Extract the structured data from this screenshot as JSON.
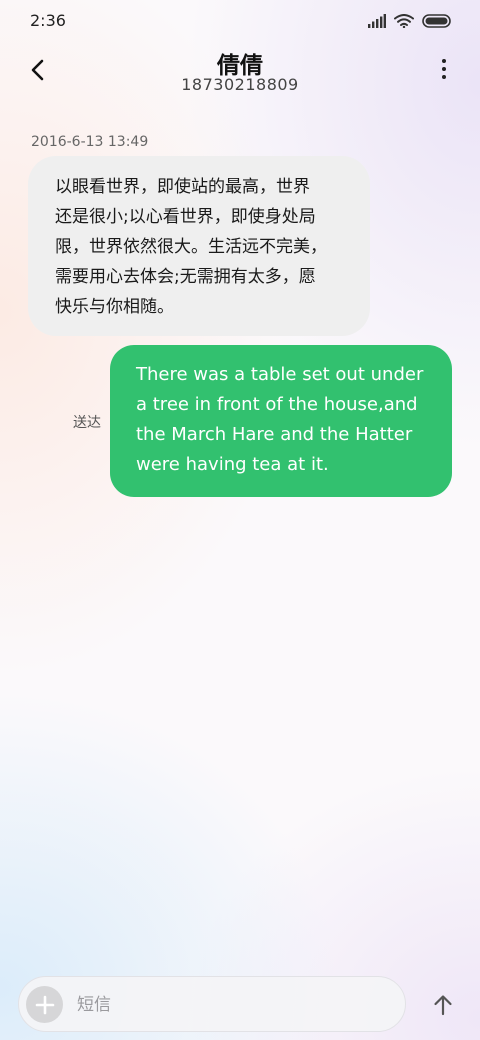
{
  "status_bar": {
    "time": "2:36",
    "icons": [
      "signal-icon",
      "wifi-icon",
      "battery-icon"
    ]
  },
  "header": {
    "contact_name": "倩倩",
    "contact_number": "18730218809",
    "icons": [
      "back-arrow-icon",
      "more-vertical-icon"
    ]
  },
  "conversation": {
    "timestamp": "2016-6-13 13:49",
    "incoming": {
      "lines": [
        "以眼看世界，即使站的最高，世界",
        "还是很小;以心看世界，即使身处局",
        "限，世界依然很大。生活远不完美，",
        "需要用心去体会;无需拥有太多，愿",
        "快乐与你相随。"
      ]
    },
    "outgoing": {
      "lines": [
        "There was a table set out under",
        "a tree in front of the house,and",
        "the March Hare and the Hatter",
        "were having tea at it."
      ],
      "status": "送达"
    }
  },
  "composer": {
    "placeholder": "短信",
    "value": "",
    "icons": [
      "add-icon",
      "send-arrow-icon"
    ]
  },
  "colors": {
    "outgoing_bubble": "#32c16f",
    "incoming_bubble": "#efefef"
  }
}
